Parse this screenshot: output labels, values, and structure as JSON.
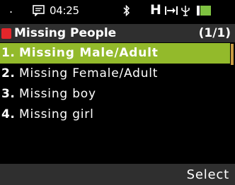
{
  "status_bar": {
    "signal_glyph": ".",
    "time": "04:25",
    "network": "H",
    "icons": [
      "message-icon",
      "bluetooth-icon",
      "flight-mode-icon",
      "usb-icon",
      "battery-icon"
    ],
    "battery_color": "#7fc241"
  },
  "title_bar": {
    "title": "Missing People",
    "page_count": "(1/1)",
    "accent_color": "#e4262b"
  },
  "list": {
    "items": [
      {
        "number": "1.",
        "label": "Missing Male/Adult"
      },
      {
        "number": "2.",
        "label": "Missing Female/Adult"
      },
      {
        "number": "3.",
        "label": "Missing boy"
      },
      {
        "number": "4.",
        "label": "Missing girl"
      }
    ],
    "selected_index": 0,
    "highlight_color": "#93ba2b"
  },
  "softkeys": {
    "right": "Select"
  }
}
